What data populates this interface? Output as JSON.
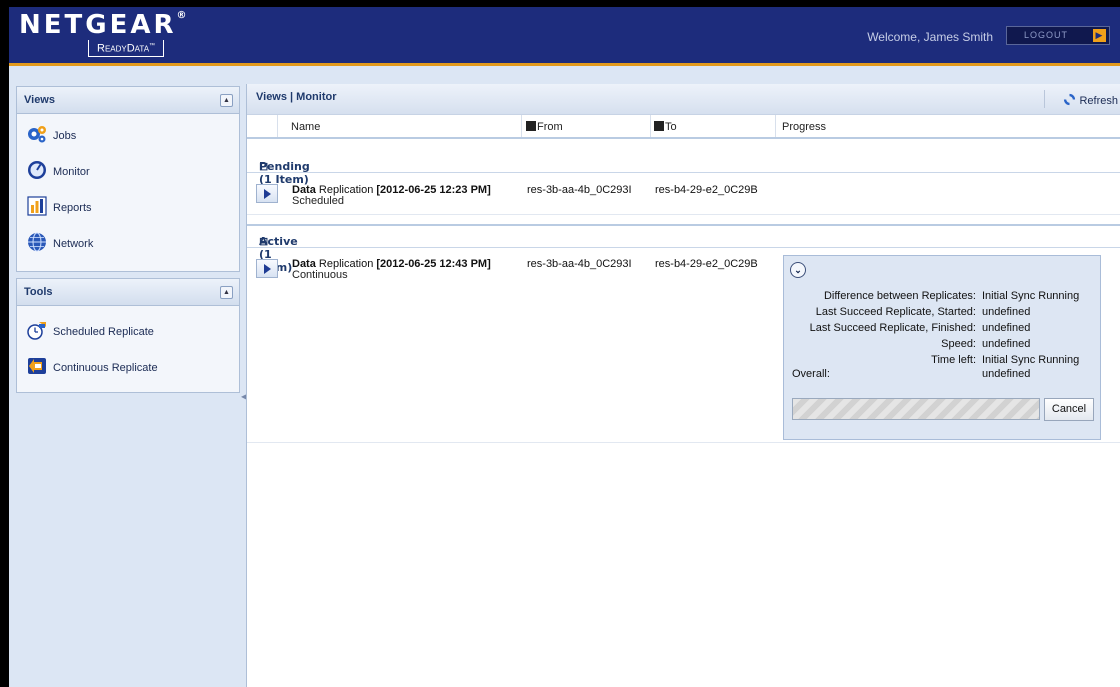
{
  "header": {
    "brand": "NETGEAR",
    "brand_registered": "®",
    "product": "ReadyData",
    "trademark": "™",
    "welcome": "Welcome, James Smith",
    "logout": "LOGOUT",
    "colors": {
      "header_bg": "#1d2c7c",
      "accent": "#e39a1c"
    }
  },
  "sidebar": {
    "views": {
      "title": "Views",
      "items": [
        {
          "label": "Jobs",
          "icon": "jobs-gears-icon"
        },
        {
          "label": "Monitor",
          "icon": "monitor-gauge-icon"
        },
        {
          "label": "Reports",
          "icon": "reports-bar-chart-icon"
        },
        {
          "label": "Network",
          "icon": "network-globe-icon"
        }
      ]
    },
    "tools": {
      "title": "Tools",
      "items": [
        {
          "label": "Scheduled Replicate",
          "icon": "scheduled-replicate-icon"
        },
        {
          "label": "Continuous Replicate",
          "icon": "continuous-replicate-icon"
        }
      ]
    }
  },
  "main": {
    "title": "Views | Monitor",
    "refresh": "Refresh",
    "columns": [
      "Name",
      "From",
      "To",
      "Progress"
    ],
    "groups": [
      {
        "label": "Pending (1 Item)",
        "job": {
          "name_bold": "Data",
          "name_rest": "Replication",
          "timestamp": "[2012-06-25 12:23 PM]",
          "from": "res-3b-aa-4b_0C293I",
          "to": "res-b4-29-e2_0C29B",
          "status": "Scheduled"
        }
      },
      {
        "label": "Active (1 Item)",
        "job": {
          "name_bold": "Data",
          "name_rest": "Replication",
          "timestamp": "[2012-06-25 12:43 PM]",
          "from": "res-3b-aa-4b_0C293I",
          "to": "res-b4-29-e2_0C29B",
          "status": "Continuous"
        }
      }
    ],
    "progress": {
      "rows": [
        {
          "label": "Difference between Replicates:",
          "value": "Initial Sync Running"
        },
        {
          "label": "Last Succeed Replicate, Started:",
          "value": "undefined"
        },
        {
          "label": "Last Succeed Replicate, Finished:",
          "value": "undefined"
        },
        {
          "label": "Speed:",
          "value": "undefined"
        },
        {
          "label": "Time left:",
          "value": "Initial Sync Running"
        }
      ],
      "overall_label": "Overall:",
      "overall_value": "undefined",
      "cancel": "Cancel"
    }
  }
}
